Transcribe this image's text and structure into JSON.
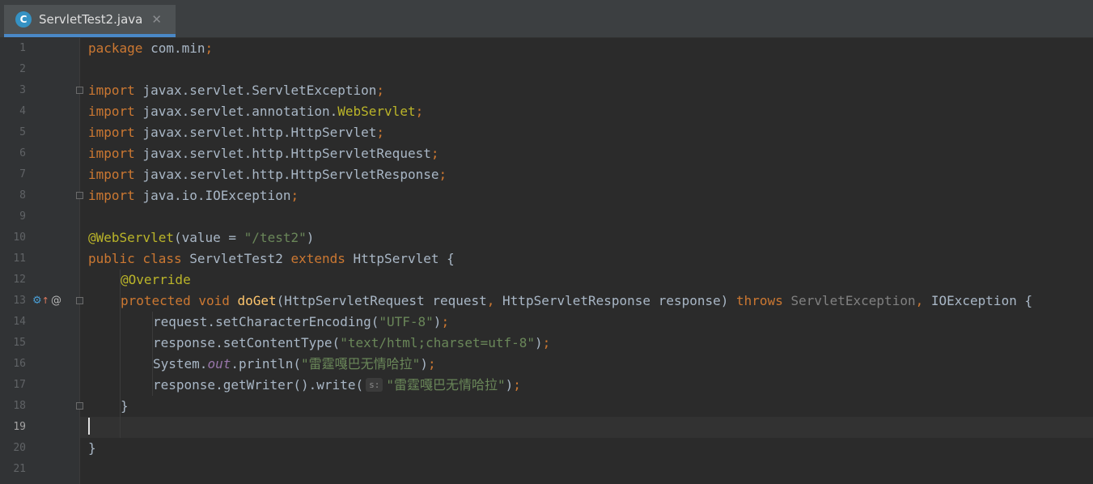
{
  "tab": {
    "icon_letter": "C",
    "filename": "ServletTest2.java",
    "close_glyph": "✕"
  },
  "gutter": {
    "line_numbers": [
      "1",
      "2",
      "3",
      "4",
      "5",
      "6",
      "7",
      "8",
      "9",
      "10",
      "11",
      "12",
      "13",
      "14",
      "15",
      "16",
      "17",
      "18",
      "19",
      "20",
      "21"
    ],
    "active_line": 19
  },
  "code": {
    "l1": {
      "kw": "package",
      "rest": " com.min",
      "semi": ";"
    },
    "l3": {
      "kw": "import",
      "rest": " javax.servlet.ServletException",
      "semi": ";"
    },
    "l4": {
      "kw": "import",
      "rest": " javax.servlet.annotation.",
      "ann": "WebServlet",
      "semi": ";"
    },
    "l5": {
      "kw": "import",
      "rest": " javax.servlet.http.HttpServlet",
      "semi": ";"
    },
    "l6": {
      "kw": "import",
      "rest": " javax.servlet.http.HttpServletRequest",
      "semi": ";"
    },
    "l7": {
      "kw": "import",
      "rest": " javax.servlet.http.HttpServletResponse",
      "semi": ";"
    },
    "l8": {
      "kw": "import",
      "rest": " java.io.IOException",
      "semi": ";"
    },
    "l10": {
      "ann": "@WebServlet",
      "open": "(value = ",
      "str": "\"/test2\"",
      "close": ")"
    },
    "l11": {
      "kw1": "public",
      "kw2": " class",
      "name": " ServletTest2 ",
      "kw3": "extends",
      "rest": " HttpServlet {"
    },
    "l12": {
      "ann": "@Override"
    },
    "l13": {
      "kw1": "protected",
      "kw2": " void ",
      "fn": "doGet",
      "p1": "(HttpServletRequest request",
      "comma1": ",",
      "p2": " HttpServletResponse response) ",
      "kw3": "throws",
      "ex1": " ServletException",
      "comma2": ",",
      "ex2": " IOException {"
    },
    "l14": {
      "pre": "request.setCharacterEncoding(",
      "str": "\"UTF-8\"",
      "post": ")",
      "semi": ";"
    },
    "l15": {
      "pre": "response.setContentType(",
      "str": "\"text/html;charset=utf-8\"",
      "post": ")",
      "semi": ";"
    },
    "l16": {
      "pre": "System.",
      "static": "out",
      "mid": ".println(",
      "str": "\"雷霆嘎巴无情哈拉\"",
      "post": ")",
      "semi": ";"
    },
    "l17": {
      "pre": "response.getWriter().write(",
      "hint": "s:",
      "str": "\"雷霆嘎巴无情哈拉\"",
      "post": ")",
      "semi": ";"
    },
    "l18": {
      "text": "}"
    },
    "l20": {
      "text": "}"
    }
  },
  "colors": {
    "editor_bg": "#2b2b2b",
    "gutter_bg": "#313335",
    "keyword": "#cc7832",
    "annotation": "#bbb529",
    "string": "#6a8759",
    "function": "#ffc66d",
    "static_field": "#9876aa",
    "text": "#a9b7c6",
    "tab_underline": "#4a88c7"
  },
  "icons": {
    "line13": [
      "override-method-icon",
      "annotation-at-icon"
    ]
  }
}
